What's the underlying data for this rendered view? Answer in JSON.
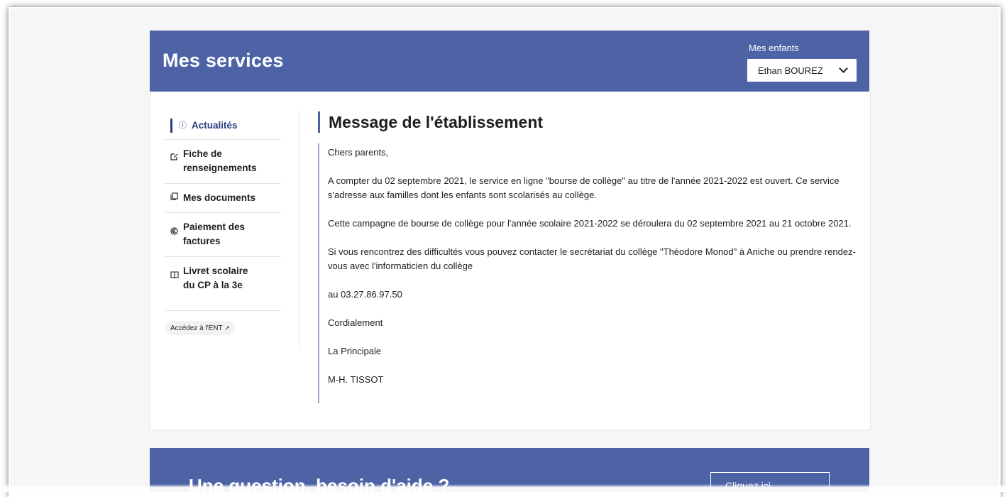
{
  "header": {
    "title": "Mes services",
    "children_label": "Mes enfants",
    "selected_child": "Ethan BOUREZ"
  },
  "sidebar": {
    "items": [
      {
        "label": "Actualités",
        "icon": "info-icon",
        "active": true
      },
      {
        "label": "Fiche de renseignements",
        "icon": "edit-form-icon",
        "active": false
      },
      {
        "label": "Mes documents",
        "icon": "documents-icon",
        "active": false
      },
      {
        "label": "Paiement des factures",
        "icon": "payment-icon",
        "active": false
      },
      {
        "label": "Livret scolaire du CP à la 3e",
        "icon": "book-icon",
        "active": false
      }
    ],
    "ent_link": "Accédez à l'ENT"
  },
  "message": {
    "title": "Message de l'établissement",
    "paragraphs": [
      "Chers parents,",
      "A compter du 02 septembre 2021, le service en ligne \"bourse de collège\" au titre de l'année 2021-2022 est ouvert. Ce service s'adresse aux familles dont les enfants sont scolarisés au collège.",
      "Cette campagne de bourse de collège pour l'année scolaire 2021-2022 se déroulera du 02 septembre 2021 au 21 octobre 2021.",
      "Si vous rencontrez des difficultés vous pouvez contacter le secrétariat du collège \"Théodore Monod\" à Aniche ou prendre rendez-vous avec l'informaticien du collège",
      "au 03.27.86.97.50",
      "Cordialement",
      "La Principale",
      "M-H. TISSOT"
    ]
  },
  "footer": {
    "question": "Une question, besoin d'aide ?",
    "button_label": "Cliquez ici"
  },
  "colors": {
    "header_bg": "#4d63a6",
    "accent": "#2a3d7c",
    "message_border": "#9aa8cf"
  }
}
